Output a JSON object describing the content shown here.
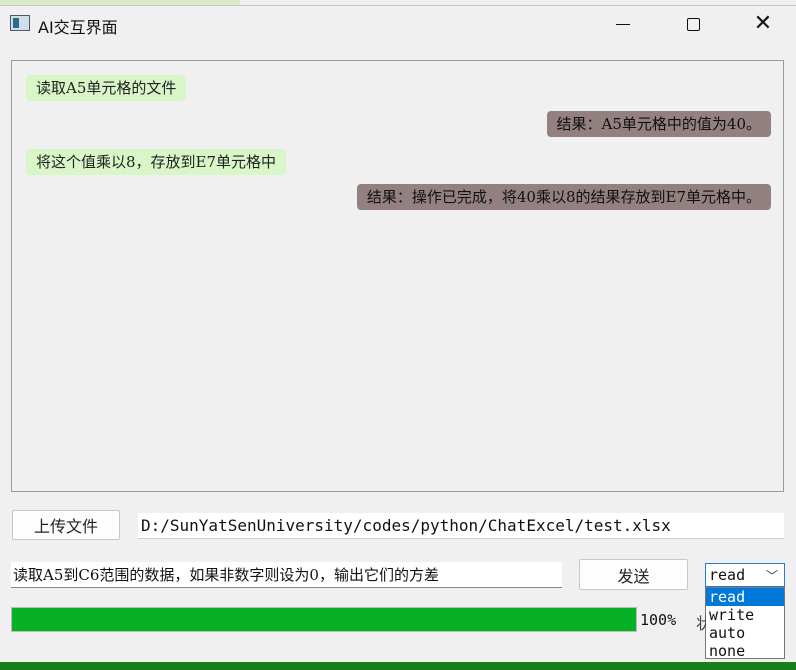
{
  "window": {
    "title": "AI交互界面",
    "controls": {
      "minimize": "",
      "maximize": "",
      "close": "✕"
    }
  },
  "chat": {
    "messages": [
      {
        "role": "user",
        "text": "读取A5单元格的文件"
      },
      {
        "role": "ai",
        "text": "结果：A5单元格中的值为40。"
      },
      {
        "role": "user",
        "text": "将这个值乘以8，存放到E7单元格中"
      },
      {
        "role": "ai",
        "text": "结果：操作已完成，将40乘以8的结果存放到E7单元格中。"
      }
    ]
  },
  "upload": {
    "button_label": "上传文件",
    "file_path": "D:/SunYatSenUniversity/codes/python/ChatExcel/test.xlsx"
  },
  "input": {
    "query_value": "读取A5到C6范围的数据，如果非数字则设为0，输出它们的方差",
    "send_label": "发送"
  },
  "mode": {
    "selected": "read",
    "options": [
      "read",
      "write",
      "auto",
      "none"
    ]
  },
  "progress": {
    "value": 1.0,
    "text": "100%",
    "status_label": "状"
  },
  "colors": {
    "user_bubble": "#d9f6c8",
    "ai_bubble": "#938080",
    "progress": "#06b025",
    "selection": "#0078d7"
  }
}
